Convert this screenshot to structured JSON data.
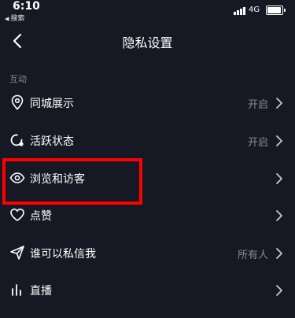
{
  "status_bar": {
    "time": "6:10",
    "back_app": "搜索",
    "network": "4G"
  },
  "nav": {
    "title": "隐私设置"
  },
  "section": {
    "label": "互动"
  },
  "rows": [
    {
      "label": "同城展示",
      "value": "开启",
      "icon": "location-pin-icon"
    },
    {
      "label": "活跃状态",
      "value": "开启",
      "icon": "activity-status-icon"
    },
    {
      "label": "浏览和访客",
      "value": "",
      "icon": "eye-icon"
    },
    {
      "label": "点赞",
      "value": "",
      "icon": "heart-icon"
    },
    {
      "label": "谁可以私信我",
      "value": "所有人",
      "icon": "send-icon"
    },
    {
      "label": "直播",
      "value": "",
      "icon": "live-bars-icon"
    }
  ],
  "colors": {
    "background": "#161823",
    "secondary_text": "#8a8b91",
    "highlight": "#ff0000"
  }
}
